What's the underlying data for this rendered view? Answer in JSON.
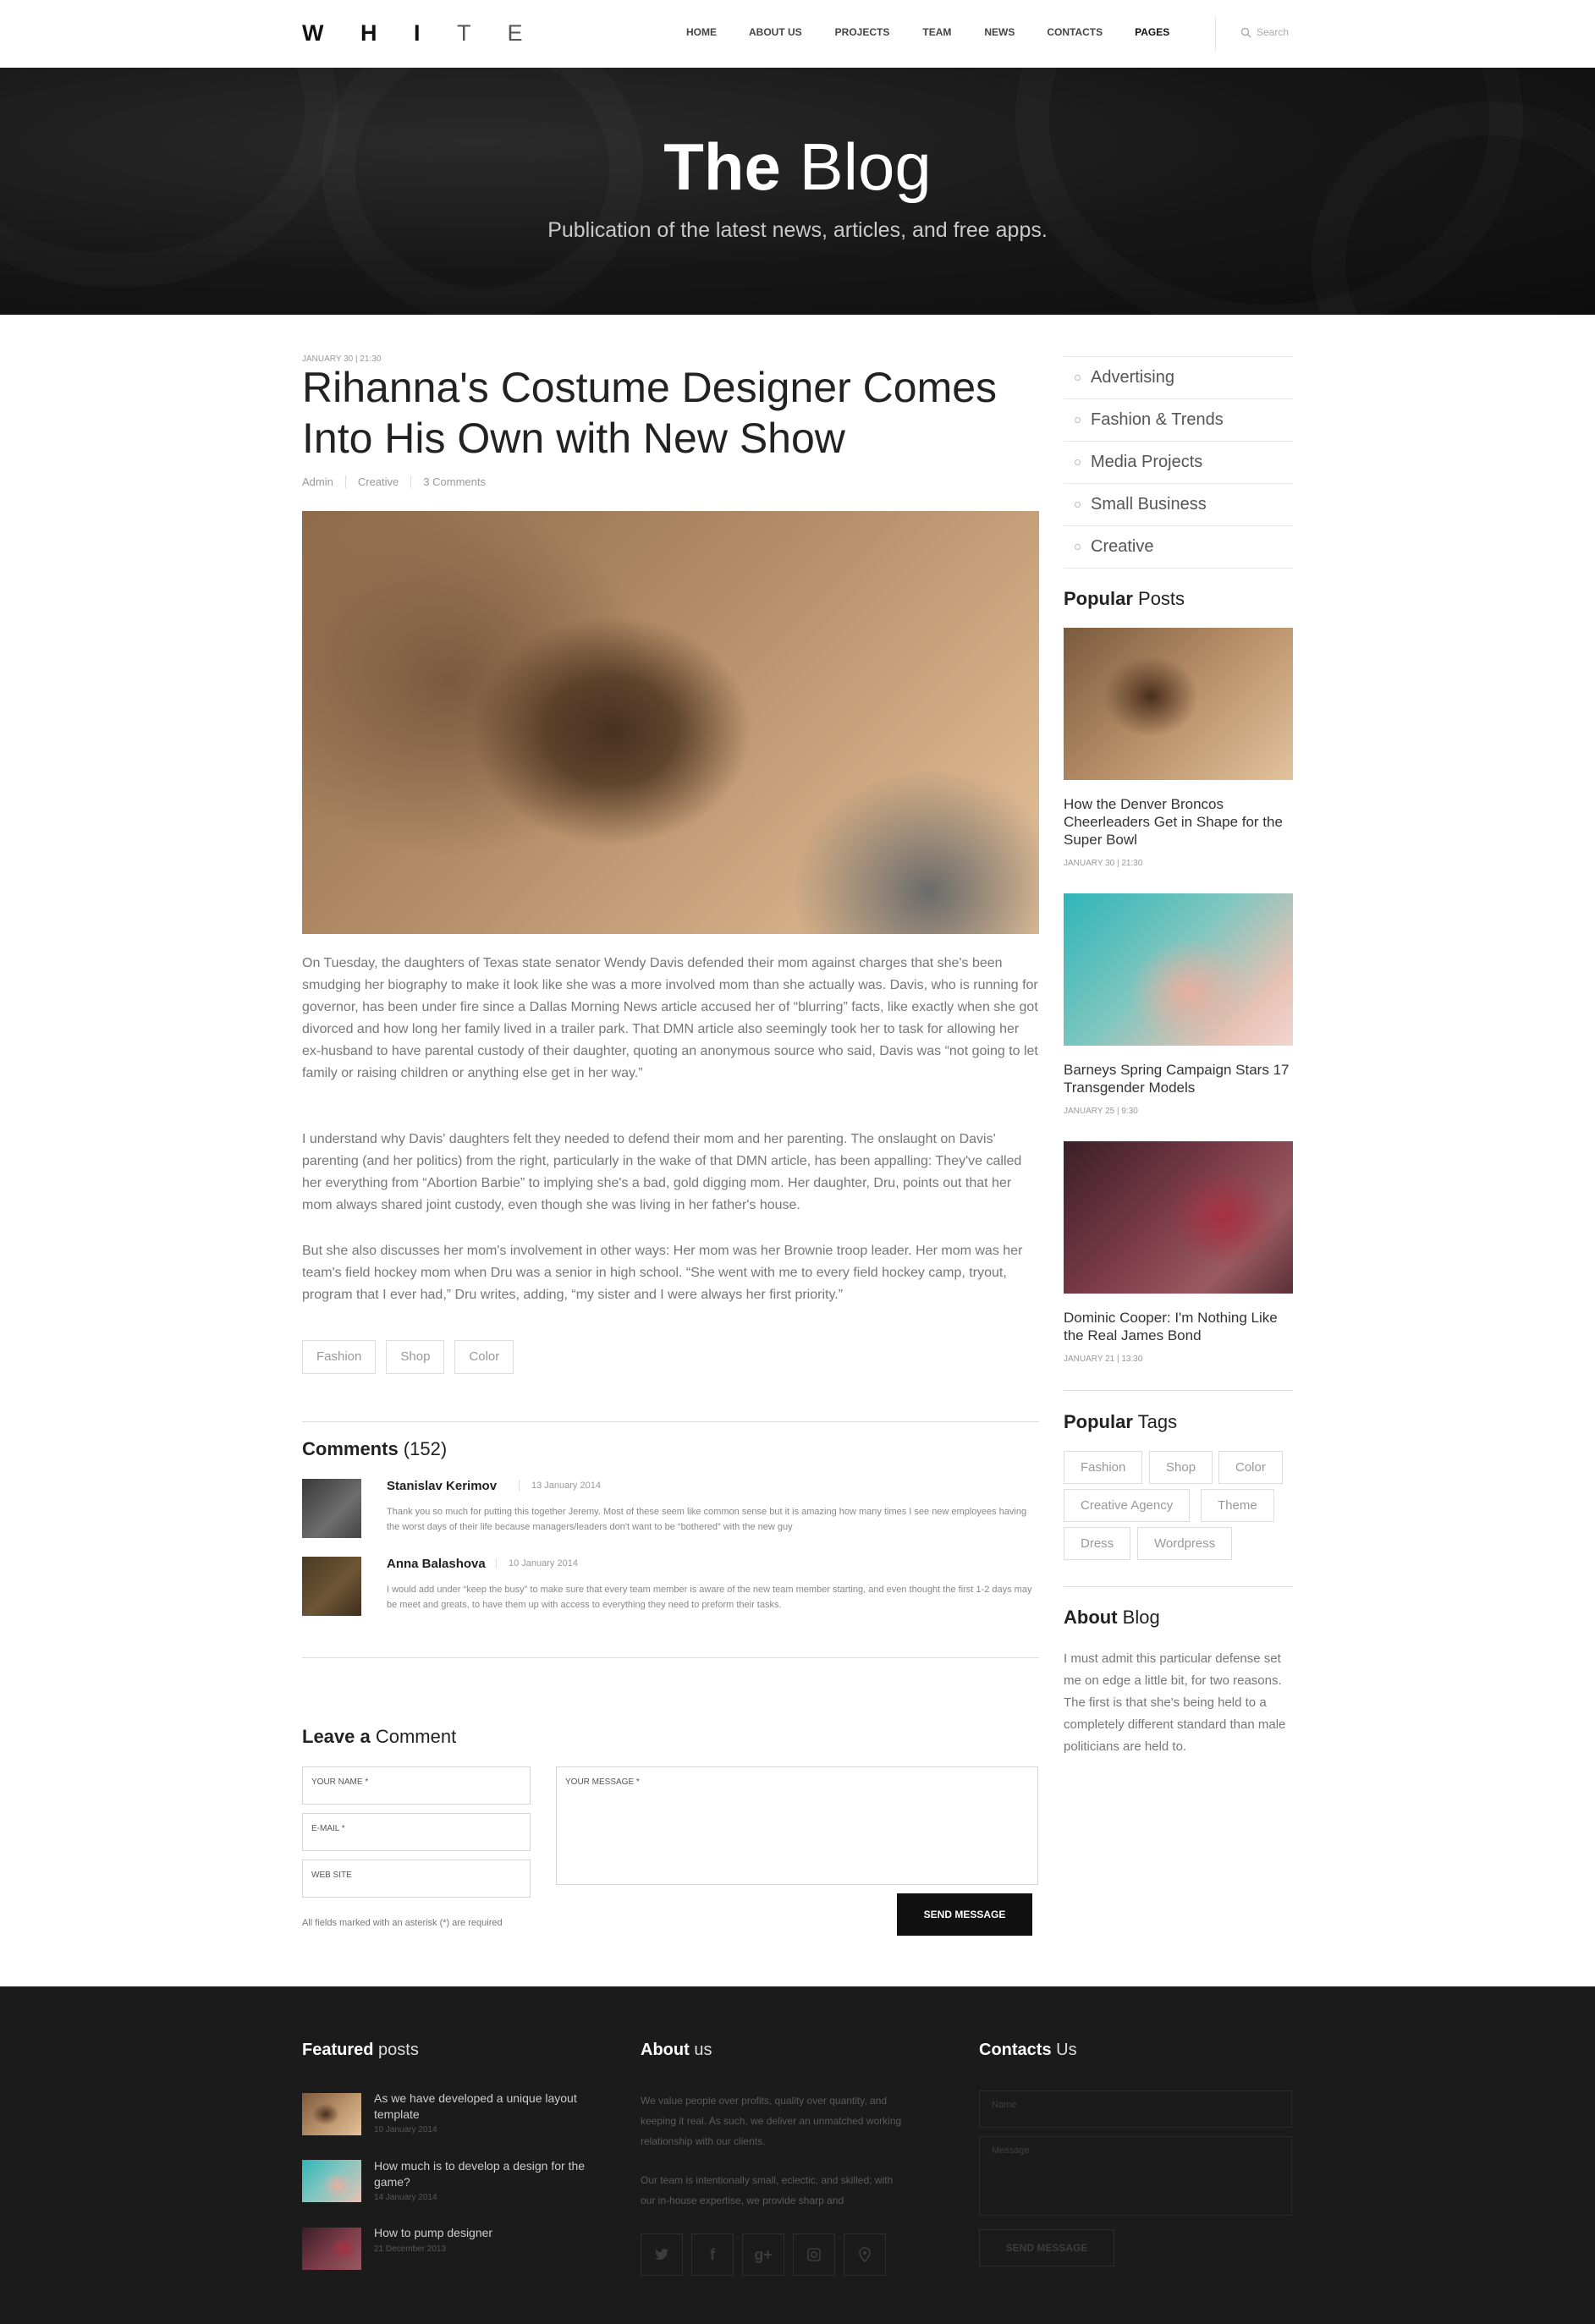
{
  "header": {
    "logo_bold": "W H I",
    "logo_light": "T E",
    "nav": [
      "HOME",
      "ABOUT US",
      "PROJECTS",
      "TEAM",
      "NEWS",
      "CONTACTS",
      "PAGES"
    ],
    "search_placeholder": "Search"
  },
  "hero": {
    "title_bold": "The",
    "title_light": " Blog",
    "subtitle": "Publication of the latest news, articles, and free apps."
  },
  "post": {
    "date": "JANUARY 30 | 21:30",
    "title": "Rihanna's Costume Designer Comes Into His Own with New Show",
    "meta": [
      "Admin",
      "Creative",
      "3 Comments"
    ],
    "paragraphs": [
      "On Tuesday, the daughters of Texas state senator Wendy Davis defended their mom against charges that she's been smudging her biography to make it look like she was a more involved mom than she actually was. Davis, who is running for governor, has been under fire since a Dallas Morning News article accused her of “blurring” facts, like exactly when she got divorced and how long her family lived in a trailer park. That DMN article also seemingly took her to task for allowing her ex-husband to have parental custody of their daughter, quoting an anonymous source who said, Davis was “not going to let family or raising children or anything else get in her way.”",
      "I understand why Davis' daughters felt they needed to defend their mom and her parenting. The onslaught on Davis' parenting (and her politics) from the right, particularly in the wake of that DMN article, has been appalling: They've called her everything from “Abortion Barbie” to implying she's a bad, gold digging mom. Her daughter, Dru, points out that her mom always shared joint custody, even though she was living in her father's house.",
      "But she also discusses her mom's involvement in other ways: Her mom was her Brownie troop leader. Her mom was her team's field hockey mom when Dru was a senior in high school. “She went with me to every field hockey camp, tryout, program that I ever had,” Dru writes, adding, “my sister and I were always her first priority.”"
    ],
    "tags": [
      "Fashion",
      "Shop",
      "Color"
    ]
  },
  "comments": {
    "title_bold": "Comments",
    "count": " (152)",
    "items": [
      {
        "author": "Stanislav Kerimov",
        "date": "13 January 2014",
        "text": "Thank you so much for putting this together Jeremy. Most of these seem like common sense but it is amazing how many times I see new employees having the worst days of their life because managers/leaders don't want to be “bothered” with the new guy"
      },
      {
        "author": "Anna Balashova",
        "date": "10 January 2014",
        "text": "I would add under “keep the busy” to make sure that every team member is aware of the new team member starting, and even thought the first 1-2 days may be meet and greats, to have them up with access to everything they need to preform their tasks."
      }
    ]
  },
  "leave_comment": {
    "title_bold": "Leave a",
    "title_light": " Comment",
    "name_placeholder": "YOUR NAME *",
    "email_placeholder": "E-MAIL *",
    "website_placeholder": "WEB SITE",
    "message_placeholder": "YOUR MESSAGE *",
    "required_note": "All fields marked with an asterisk (*) are required",
    "send_label": "SEND MESSAGE"
  },
  "sidebar": {
    "categories": [
      "Advertising",
      "Fashion & Trends",
      "Media Projects",
      "Small Business",
      "Creative"
    ],
    "popular_posts_title_bold": "Popular",
    "popular_posts_title_light": " Posts",
    "popular_posts": [
      {
        "title": "How the Denver Broncos Cheerleaders Get in Shape for the Super Bowl",
        "date": "JANUARY 30 | 21:30"
      },
      {
        "title": "Barneys Spring Campaign Stars 17 Transgender Models",
        "date": "JANUARY 25 | 9:30"
      },
      {
        "title": "Dominic Cooper: I'm Nothing Like the Real James Bond",
        "date": "JANUARY 21 | 13:30"
      }
    ],
    "popular_tags_title_bold": "Popular",
    "popular_tags_title_light": " Tags",
    "popular_tags": [
      "Fashion",
      "Shop",
      "Color",
      "Creative Agency",
      "Theme",
      "Dress",
      "Wordpress"
    ],
    "about_title_bold": "About",
    "about_title_light": " Blog",
    "about_text": "I must admit this particular defense set me on edge a little bit, for two reasons. The first is that she's being held to a completely different standard than male politicians are held to."
  },
  "footer": {
    "featured_title_bold": "Featured",
    "featured_title_light": " posts",
    "featured_posts": [
      {
        "title": "As we have developed a unique layout template",
        "date": "10 January 2014"
      },
      {
        "title": "How much is to develop a design for the game?",
        "date": "14 January 2014"
      },
      {
        "title": "How to pump designer",
        "date": "21 December 2013"
      }
    ],
    "about_title_bold": "About",
    "about_title_light": " us",
    "about_paragraphs": [
      "We value people over profits, quality over quantity, and keeping it real. As such, we deliver an unmatched working relationship with our clients.",
      "Our team is intentionally small, eclectic, and skilled; with our in-house expertise, we provide sharp and"
    ],
    "social": [
      "twitter-icon",
      "facebook-icon",
      "google-plus-icon",
      "instagram-icon",
      "map-pin-icon"
    ],
    "contacts_title_bold": "Contacts",
    "contacts_title_light": " Us",
    "name_placeholder": "Name",
    "message_placeholder": "Message",
    "send_label": "SEND MESSAGE"
  },
  "colors": {
    "dark": "#111111",
    "footer_bg": "#1b1b1b",
    "text_muted": "#777777",
    "border": "#dddddd"
  }
}
